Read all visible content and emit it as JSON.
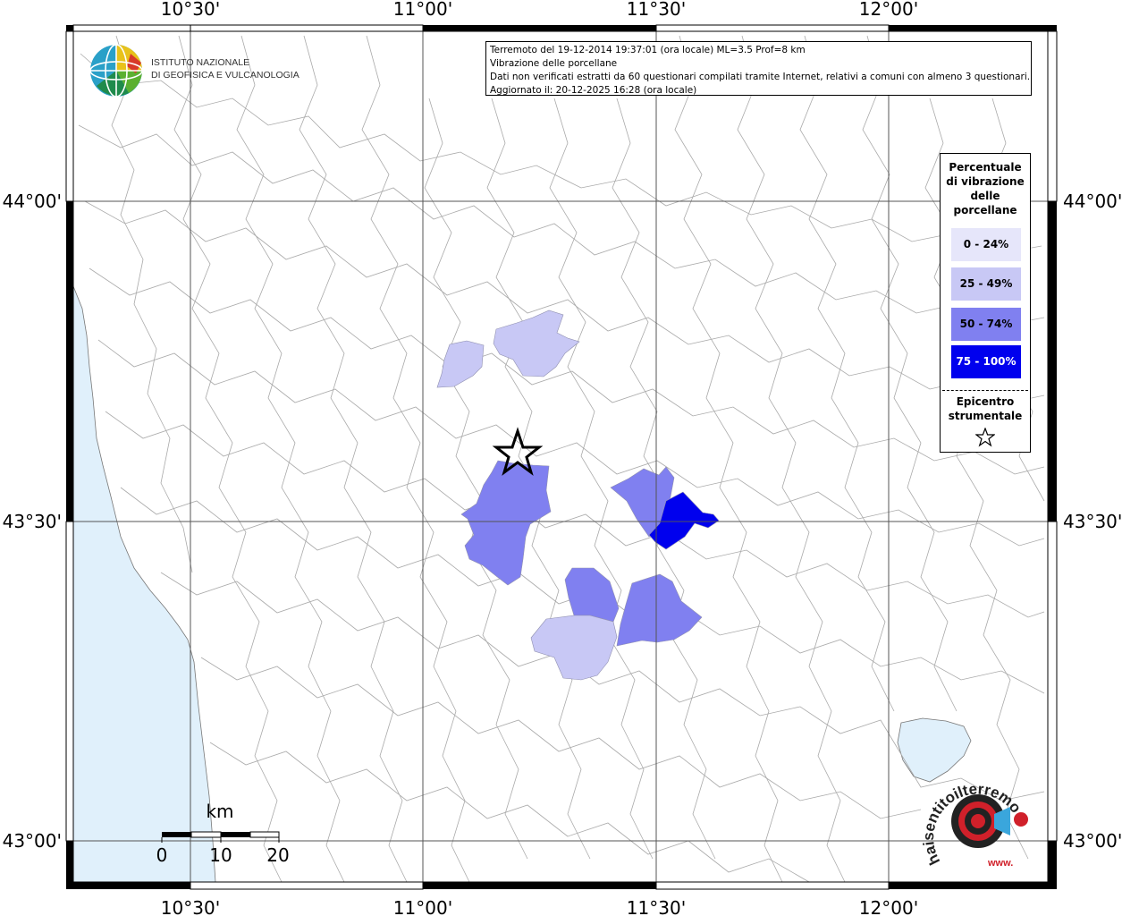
{
  "map": {
    "title_lines": [
      "Terremoto del 19-12-2014 19:37:01 (ora locale) ML=3.5 Prof=8 km",
      "Vibrazione delle porcellane",
      "Dati non verificati estratti da 60 questionari compilati tramite Internet, relativi a comuni con almeno 3 questionari.",
      "Aggiornato il: 20-12-2025 16:28 (ora locale)"
    ],
    "lon_labels": [
      "10°30'",
      "11°00'",
      "11°30'",
      "12°00'"
    ],
    "lat_labels": [
      "44°00'",
      "43°30'",
      "43°00'"
    ],
    "scale": {
      "unit": "km",
      "ticks": [
        "0",
        "10",
        "20"
      ]
    },
    "water_color": "#e0f0fb",
    "grid_color": "#555555"
  },
  "legend": {
    "title": "Percentuale di vibrazione delle porcellane",
    "classes": [
      {
        "label": "0 - 24%",
        "color": "#e6e6fa"
      },
      {
        "label": "25 - 49%",
        "color": "#c8c8f5"
      },
      {
        "label": "50 - 74%",
        "color": "#8080f0"
      },
      {
        "label": "75 - 100%",
        "color": "#0000ee",
        "text_color": "#ffffff"
      }
    ],
    "epicenter_label": "Epicentro strumentale",
    "epicenter_symbol": "star-icon"
  },
  "logos": {
    "ingv_line1": "ISTITUTO NAZIONALE",
    "ingv_line2": "DI GEOFISICA E VULCANOLOGIA",
    "hst_text": "haisentitoilterremoto.it",
    "hst_www": "www."
  }
}
